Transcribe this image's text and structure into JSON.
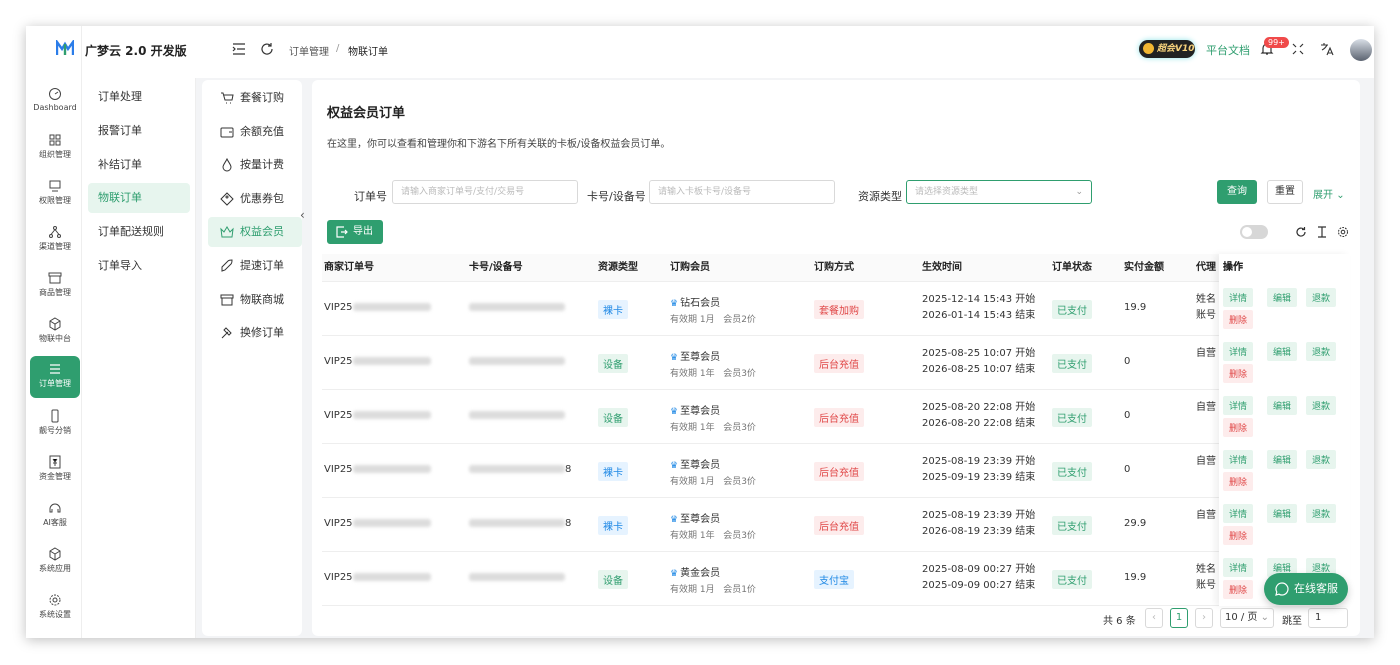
{
  "header": {
    "brand": "广梦云 2.0 开发版",
    "breadcrumb": [
      "订单管理",
      "/",
      "物联订单"
    ],
    "vip_label": "超会V10",
    "doc_link": "平台文档",
    "badge": "99+"
  },
  "rail": [
    {
      "label": "Dashboard",
      "icon": "gauge-icon"
    },
    {
      "label": "组织管理",
      "icon": "grid-icon"
    },
    {
      "label": "权限管理",
      "icon": "monitor-icon"
    },
    {
      "label": "渠道管理",
      "icon": "network-icon"
    },
    {
      "label": "商品管理",
      "icon": "store-icon"
    },
    {
      "label": "物联中台",
      "icon": "cube-icon"
    },
    {
      "label": "订单管理",
      "icon": "list-icon"
    },
    {
      "label": "靓号分销",
      "icon": "phone-icon"
    },
    {
      "label": "资金管理",
      "icon": "yuan-icon"
    },
    {
      "label": "AI客服",
      "icon": "headset-icon"
    },
    {
      "label": "系统应用",
      "icon": "package-icon"
    },
    {
      "label": "系统设置",
      "icon": "gear-icon"
    }
  ],
  "menu2": [
    "订单处理",
    "报警订单",
    "补结订单",
    "物联订单",
    "订单配送规则",
    "订单导入"
  ],
  "menu3": [
    "套餐订购",
    "余额充值",
    "按量计费",
    "优惠券包",
    "权益会员",
    "提速订单",
    "物联商城",
    "换修订单"
  ],
  "panel": {
    "title": "权益会员订单",
    "desc": "在这里，你可以查看和管理你和下游名下所有关联的卡板/设备权益会员订单。"
  },
  "filters": {
    "order_label": "订单号",
    "order_placeholder": "请输入商家订单号/支付/交易号",
    "card_label": "卡号/设备号",
    "card_placeholder": "请输入卡板卡号/设备号",
    "type_label": "资源类型",
    "type_placeholder": "请选择资源类型",
    "query": "查询",
    "reset": "重置",
    "expand": "展开"
  },
  "toolbar": {
    "export": "导出"
  },
  "table": {
    "headers": [
      "商家订单号",
      "卡号/设备号",
      "资源类型",
      "订购会员",
      "订购方式",
      "生效时间",
      "订单状态",
      "实付金额",
      "代理",
      "操作"
    ],
    "ops": [
      "详情",
      "编辑",
      "退款",
      "删除"
    ],
    "rows": [
      {
        "order": "VIP25",
        "card_suffix": "",
        "type": "裸卡",
        "type_color": "blue",
        "member": "钻石会员",
        "period": "有效期 1月",
        "level": "会员2价",
        "method": "套餐加购",
        "method_color": "red",
        "start": "2025-12-14 15:43 开始",
        "end": "2026-01-14 15:43 结束",
        "status": "已支付",
        "amount": "19.9",
        "agent1": "姓名",
        "agent2": "账号"
      },
      {
        "order": "VIP25",
        "card_suffix": "",
        "type": "设备",
        "type_color": "green",
        "member": "至尊会员",
        "period": "有效期 1年",
        "level": "会员3价",
        "method": "后台充值",
        "method_color": "red",
        "start": "2025-08-25 10:07 开始",
        "end": "2026-08-25 10:07 结束",
        "status": "已支付",
        "amount": "0",
        "agent1": "自营",
        "agent2": ""
      },
      {
        "order": "VIP25",
        "card_suffix": "",
        "type": "设备",
        "type_color": "green",
        "member": "至尊会员",
        "period": "有效期 1年",
        "level": "会员3价",
        "method": "后台充值",
        "method_color": "red",
        "start": "2025-08-20 22:08 开始",
        "end": "2026-08-20 22:08 结束",
        "status": "已支付",
        "amount": "0",
        "agent1": "自营",
        "agent2": ""
      },
      {
        "order": "VIP25",
        "card_suffix": "8",
        "type": "裸卡",
        "type_color": "blue",
        "member": "至尊会员",
        "period": "有效期 1月",
        "level": "会员3价",
        "method": "后台充值",
        "method_color": "red",
        "start": "2025-08-19 23:39 开始",
        "end": "2025-09-19 23:39 结束",
        "status": "已支付",
        "amount": "0",
        "agent1": "自营",
        "agent2": ""
      },
      {
        "order": "VIP25",
        "card_suffix": "8",
        "type": "裸卡",
        "type_color": "blue",
        "member": "至尊会员",
        "period": "有效期 1年",
        "level": "会员3价",
        "method": "后台充值",
        "method_color": "red",
        "start": "2025-08-19 23:39 开始",
        "end": "2026-08-19 23:39 结束",
        "status": "已支付",
        "amount": "29.9",
        "agent1": "自营",
        "agent2": ""
      },
      {
        "order": "VIP25",
        "card_suffix": "",
        "type": "设备",
        "type_color": "green",
        "member": "黄金会员",
        "period": "有效期 1月",
        "level": "会员1价",
        "method": "支付宝",
        "method_color": "blue",
        "start": "2025-08-09 00:27 开始",
        "end": "2025-09-09 00:27 结束",
        "status": "已支付",
        "amount": "19.9",
        "agent1": "姓名",
        "agent2": "账号"
      }
    ]
  },
  "pager": {
    "total": "共 6 条",
    "page": "1",
    "size": "10 / 页",
    "jump": "跳至",
    "jump_value": "1"
  },
  "support": {
    "label": "在线客服"
  },
  "colors": {
    "accent": "#2f9e6f",
    "danger": "#e04646",
    "info": "#1e88e5"
  }
}
